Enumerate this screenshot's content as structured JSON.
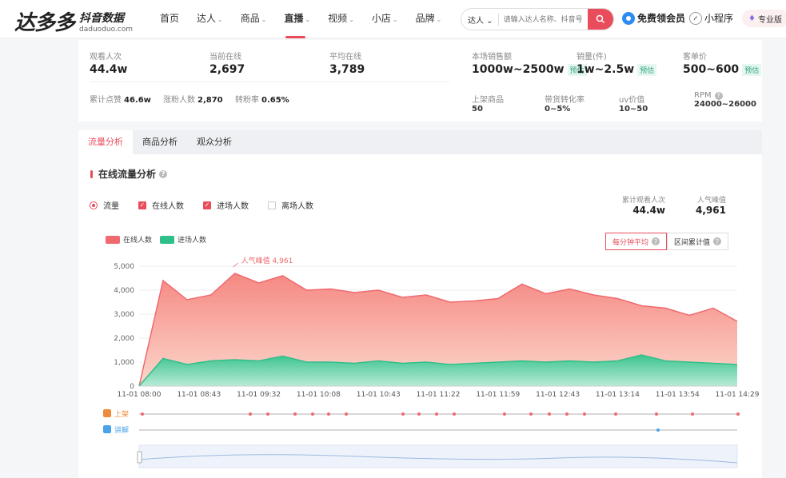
{
  "brand": {
    "name": "达多多",
    "sub_cn": "抖音数据",
    "sub_en": "daduoduo.com"
  },
  "nav": {
    "items": [
      {
        "label": "首页",
        "caret": false
      },
      {
        "label": "达人",
        "caret": true
      },
      {
        "label": "商品",
        "caret": true
      },
      {
        "label": "直播",
        "caret": true,
        "active": true
      },
      {
        "label": "视频",
        "caret": true
      },
      {
        "label": "小店",
        "caret": true
      },
      {
        "label": "品牌",
        "caret": true
      }
    ],
    "search_type": "达人",
    "search_placeholder": "请输入达人名称、抖音号",
    "vip_label": "免费领会员",
    "mini_label": "小程序",
    "pro_label": "专业版"
  },
  "stats": {
    "viewers_label": "观看人次",
    "viewers": "44.4w",
    "current_label": "当前在线",
    "current": "2,697",
    "avg_label": "平均在线",
    "avg": "3,789",
    "likes_label": "累计点赞",
    "likes": "46.6w",
    "fans_label": "涨粉人数",
    "fans": "2,870",
    "fan_rate_label": "转粉率",
    "fan_rate": "0.65%",
    "sales_label": "本场销售额",
    "sales": "1000w~2500w",
    "volume_label": "销量(件)",
    "volume": "1w~2.5w",
    "price_label": "客单价",
    "price": "500~600",
    "estimate_tag": "预估",
    "products_label": "上架商品",
    "products": "50",
    "conv_label": "带货转化率",
    "conv": "0~5%",
    "uv_label": "uv价值",
    "uv": "10~50",
    "rpm_label": "RPM",
    "rpm": "24000~26000"
  },
  "tabs": [
    "流量分析",
    "商品分析",
    "观众分析"
  ],
  "section": {
    "title": "在线流量分析",
    "radio_label": "流量",
    "checks": [
      {
        "label": "在线人数",
        "on": true
      },
      {
        "label": "进场人数",
        "on": true
      },
      {
        "label": "离场人数",
        "on": false
      }
    ],
    "total_viewers_label": "累计观看人次",
    "total_viewers": "44.4w",
    "peak_label": "人气峰值",
    "peak": "4,961",
    "mode_buttons": [
      "每分钟平均",
      "区间累计值"
    ],
    "row_labels": [
      "上架",
      "讲解"
    ]
  },
  "chart_data": {
    "type": "area",
    "x": [
      "11-01 08:00",
      "11-01 08:43",
      "11-01 09:32",
      "11-01 10:08",
      "11-01 10:43",
      "11-01 11:22",
      "11-01 11:59",
      "11-01 12:43",
      "11-01 13:14",
      "11-01 13:54",
      "11-01 14:29"
    ],
    "ylim": [
      0,
      5000
    ],
    "yticks": [
      "0",
      "1,000",
      "2,000",
      "3,000",
      "4,000",
      "5,000"
    ],
    "series": [
      {
        "name": "在线人数",
        "color": "#f0696f",
        "values": [
          0,
          4400,
          3600,
          3800,
          4700,
          4300,
          4600,
          4000,
          4050,
          3900,
          4000,
          3700,
          3800,
          3500,
          3550,
          3650,
          4250,
          3850,
          4050,
          3800,
          3650,
          3350,
          3250,
          2950,
          3250,
          2700
        ]
      },
      {
        "name": "进场人数",
        "color": "#2fbf8a",
        "values": [
          0,
          1150,
          900,
          1050,
          1100,
          1050,
          1250,
          1000,
          1000,
          950,
          1050,
          950,
          1000,
          900,
          950,
          1000,
          1050,
          1000,
          1050,
          1000,
          1050,
          1300,
          1050,
          1000,
          950,
          900
        ]
      }
    ],
    "peak_annotation": "人气峰值 4,961",
    "peak_value": 4961
  },
  "colors": {
    "accent": "#e94d5c",
    "online": "#f0696f",
    "enter": "#2fbf8a"
  }
}
